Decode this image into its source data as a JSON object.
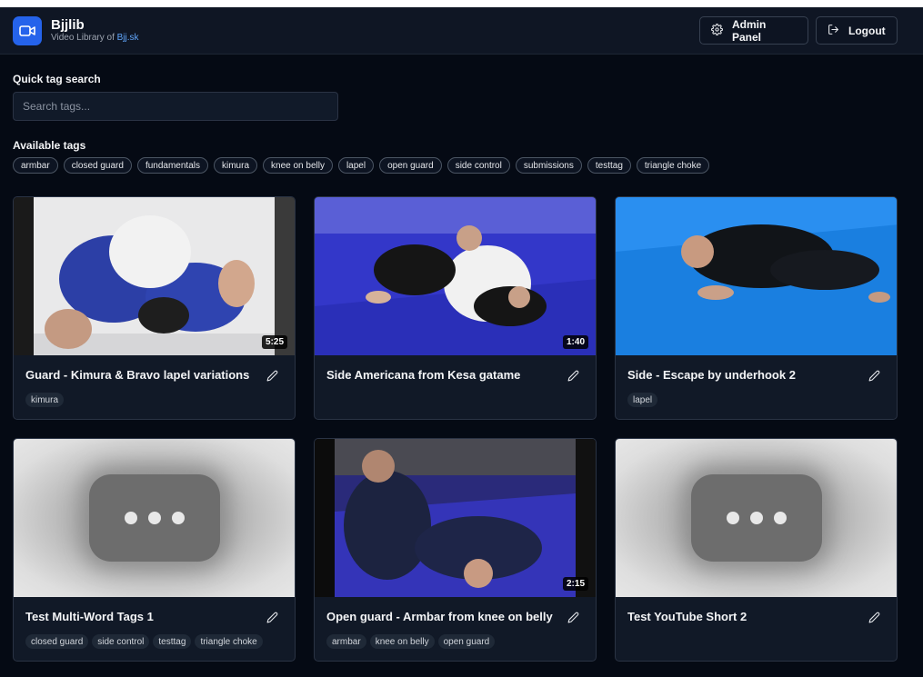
{
  "app": {
    "title": "Bjjlib",
    "subtitle_prefix": "Video Library of ",
    "subtitle_link": "Bjj.sk"
  },
  "header": {
    "admin_label": "Admin Panel",
    "logout_label": "Logout"
  },
  "search": {
    "label": "Quick tag search",
    "placeholder": "Search tags..."
  },
  "tags": {
    "label": "Available tags",
    "items": [
      "armbar",
      "closed guard",
      "fundamentals",
      "kimura",
      "knee on belly",
      "lapel",
      "open guard",
      "side control",
      "submissions",
      "testtag",
      "triangle choke"
    ]
  },
  "videos": [
    {
      "title": "Guard - Kimura & Bravo lapel variations",
      "duration": "5:25",
      "tags": [
        "kimura"
      ]
    },
    {
      "title": "Side Americana from Kesa gatame",
      "duration": "1:40",
      "tags": []
    },
    {
      "title": "Side - Escape by underhook 2",
      "duration": "",
      "tags": [
        "lapel"
      ]
    },
    {
      "title": "Test Multi-Word Tags 1",
      "duration": "",
      "tags": [
        "closed guard",
        "side control",
        "testtag",
        "triangle choke"
      ]
    },
    {
      "title": "Open guard - Armbar from knee on belly",
      "duration": "2:15",
      "tags": [
        "armbar",
        "knee on belly",
        "open guard"
      ]
    },
    {
      "title": "Test YouTube Short 2",
      "duration": "",
      "tags": []
    }
  ],
  "colors": {
    "accent": "#2563eb",
    "link": "#60a5fa",
    "background": "#050a14",
    "card": "#111927"
  }
}
